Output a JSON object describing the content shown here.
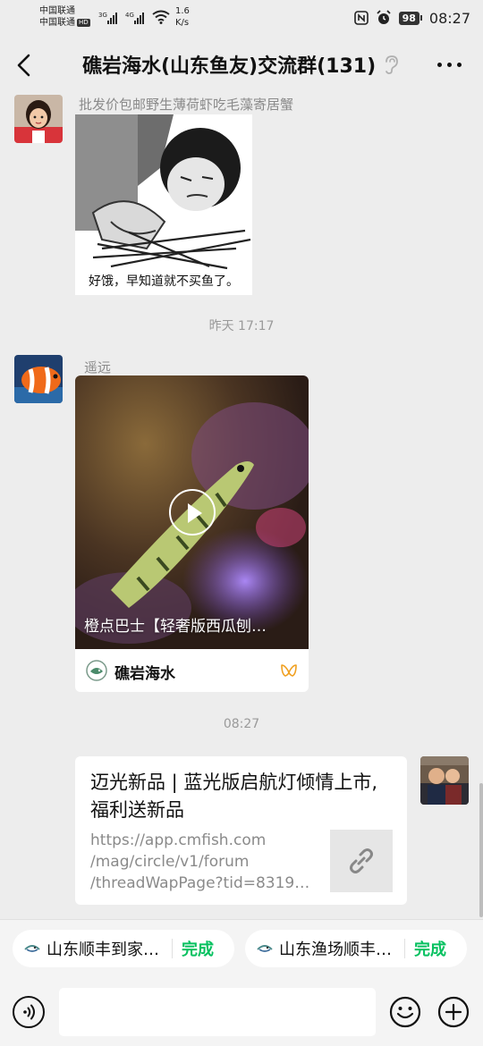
{
  "status_bar": {
    "carrier_1": "中国联通",
    "carrier_2": "中国联通",
    "hd_badge": "HD",
    "net_3g": "3G",
    "net_4g": "4G",
    "net_speed_value": "1.6",
    "net_speed_unit": "K/s",
    "battery": "98",
    "clock": "08:27"
  },
  "header": {
    "title": "礁岩海水(山东鱼友)交流群(131)"
  },
  "messages": {
    "msg1": {
      "sender": "批发价包邮野生薄荷虾吃毛藻寄居蟹",
      "image_caption": "好饿，早知道就不买鱼了。"
    },
    "time1": "昨天 17:17",
    "msg2": {
      "sender": "遥远",
      "video_caption": "橙点巴士【轻奢版西瓜刨…",
      "channel_name": "礁岩海水"
    },
    "time2": "08:27",
    "msg3": {
      "link_title": "迈光新品 | 蓝光版启航灯倾情上市,福利送新品",
      "link_url_line1": "https://app.cmfish.com",
      "link_url_line2": "/mag/circle/v1/forum",
      "link_url_line3": "/threadWapPage?tid=8319…"
    }
  },
  "quick_chips": [
    {
      "label": "山东顺丰到家…",
      "action": "完成"
    },
    {
      "label": "山东渔场顺丰…",
      "action": "完成"
    }
  ],
  "colors": {
    "background": "#ededed",
    "bubble": "#ffffff",
    "accent_green": "#07c160",
    "timestamp": "#9a9a9a"
  },
  "icons": {
    "back": "chevron-left-icon",
    "ear": "ear-icon",
    "more": "more-dots-icon",
    "play": "play-icon",
    "link": "link-icon",
    "voice": "voice-icon",
    "emoji": "emoji-icon",
    "plus": "plus-icon"
  }
}
